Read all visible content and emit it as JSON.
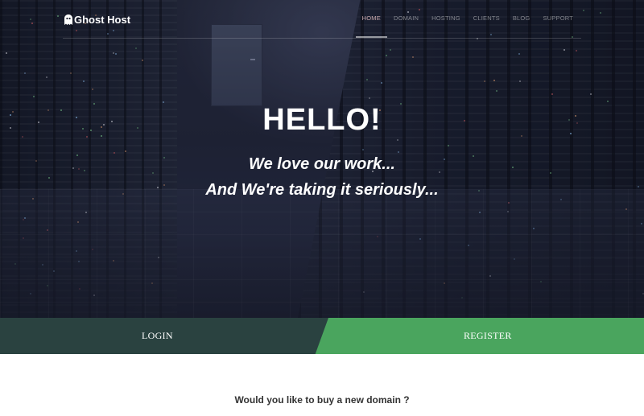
{
  "brand": {
    "name": "Ghost Host",
    "icon": "ghost-icon"
  },
  "nav": {
    "items": [
      {
        "label": "HOME",
        "active": true
      },
      {
        "label": "DOMAIN",
        "active": false
      },
      {
        "label": "HOSTING",
        "active": false
      },
      {
        "label": "CLIENTS",
        "active": false
      },
      {
        "label": "BLOG",
        "active": false
      },
      {
        "label": "SUPPORT",
        "active": false
      }
    ]
  },
  "hero": {
    "headline": "HELLO!",
    "tagline_1": "We love our work...",
    "tagline_2": "And We're taking it seriously..."
  },
  "auth": {
    "login_label": "LOGIN",
    "register_label": "REGISTER"
  },
  "domain_section": {
    "question": "Would you like to buy a new domain ?"
  },
  "colors": {
    "login_bg": "#2a4240",
    "register_bg": "#4aa55e",
    "nav_active": "#c9a9ad",
    "text_dark": "#333333"
  }
}
